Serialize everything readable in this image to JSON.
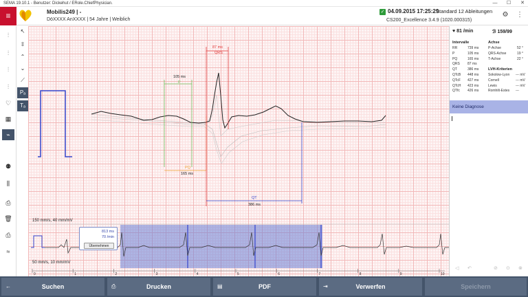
{
  "window": {
    "title": "SEMA 19.10.1 - Benutzer: Dickehut / ERole.ChiefPhysician.",
    "minimize": "—",
    "maximize": "☐",
    "close": "✕"
  },
  "header": {
    "patient_name": "Mobilis249 | -",
    "patient_info": "DöXXXX AnXXXX | 54 Jahre | Weiblich",
    "date_time": "04.09.2015 17:25:29",
    "standard": "Standard 12 Ableitungen",
    "device": "CS200_Excellence 3.4.9 (1020.000315)"
  },
  "measurements": {
    "qrs_ms": "87 ms",
    "qrs_label": "QRS",
    "p_ms": "105 ms",
    "p_label": "P",
    "pq_label": "PQ",
    "pq_ms": "165 ms",
    "qt_label": "QT",
    "qt_ms": "386 ms"
  },
  "strip": {
    "top_label": "150 mm/s, 40 mm/mV",
    "bottom_label": "50 mm/s, 10 mm/mV",
    "popup_value1": "813 ms",
    "popup_value2": "70 /min",
    "popup_button": "Übernehmen",
    "scale_ticks": [
      "0",
      "1",
      "2",
      "3",
      "4",
      "5",
      "6",
      "7",
      "8",
      "9",
      "10"
    ]
  },
  "right_panel": {
    "heart_rate": "81 /min",
    "quality": "159/99",
    "intervals_title": "Intervalle",
    "intervals": [
      {
        "k": "RR",
        "v": "739 ms"
      },
      {
        "k": "P",
        "v": "105 ms"
      },
      {
        "k": "PQ",
        "v": "165 ms"
      },
      {
        "k": "QRS",
        "v": "87 ms"
      },
      {
        "k": "QT",
        "v": "386 ms"
      },
      {
        "k": "QTcB",
        "v": "448 ms"
      },
      {
        "k": "QTcF",
        "v": "427 ms"
      },
      {
        "k": "QTcH",
        "v": "423 ms"
      },
      {
        "k": "QTfc",
        "v": "426 ms"
      }
    ],
    "axis_title": "Achse",
    "axis": [
      {
        "k": "P-Achse",
        "v": "52 °"
      },
      {
        "k": "QRS-Achse",
        "v": "19 °"
      },
      {
        "k": "T-Achse",
        "v": "22 °"
      }
    ],
    "lvh_title": "LVH-Kriterien",
    "lvh": [
      {
        "k": "Sokolow-Lyon",
        "v": "--- mV"
      },
      {
        "k": "Cornell",
        "v": "--- mV"
      },
      {
        "k": "Lewis",
        "v": "--- mV"
      },
      {
        "k": "Romhilt-Estes",
        "v": "---"
      }
    ],
    "diagnosis": "Keine Diagnose"
  },
  "bottom": {
    "search": "Suchen",
    "print": "Drucken",
    "pdf": "PDF",
    "discard": "Verwerfen",
    "save": "Speichern"
  },
  "colors": {
    "brand": "#c8102e",
    "toolbar": "#44546a",
    "selection": "#a9b3e6",
    "grid": "#f2b8b8"
  }
}
